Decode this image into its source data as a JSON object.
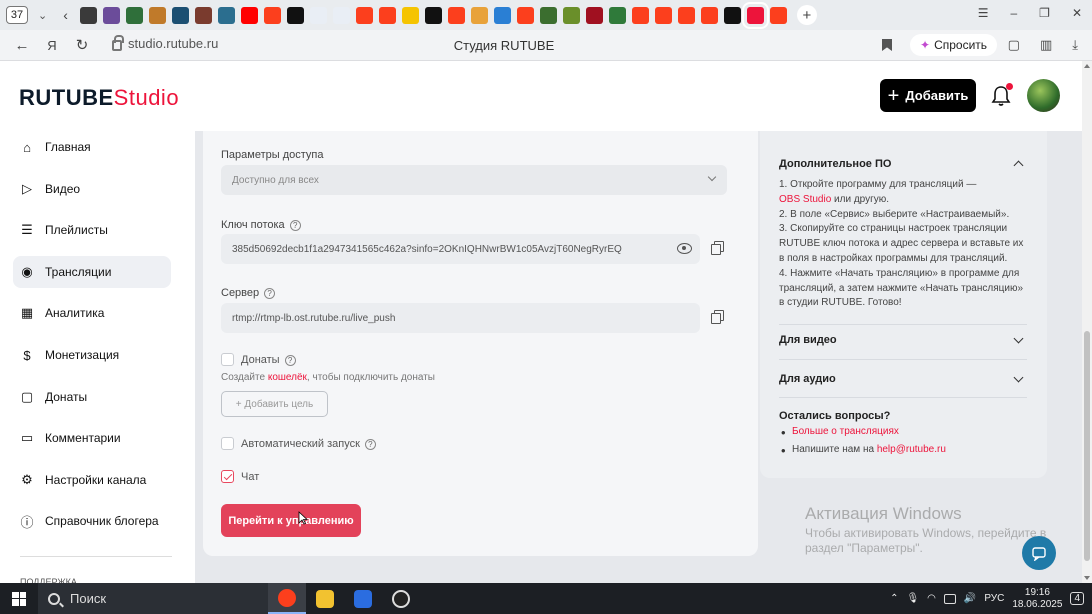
{
  "browser": {
    "tab_count": "37",
    "url": "studio.rutube.ru",
    "page_title": "Студия RUTUBE",
    "ask_label": "Спросить",
    "tab_icon_colors": [
      "#3a3a3a",
      "#6b4c9a",
      "#2f6f3a",
      "#c07a2a",
      "#1b4f72",
      "#7a3b2e",
      "#2b6e8f",
      "#ff0000",
      "#fc3f1d",
      "#111111",
      "#e9eef5",
      "#e9eef5",
      "#fc3f1d",
      "#fc3f1d",
      "#f5c400",
      "#111111",
      "#fc3f1d",
      "#e8a23a",
      "#2a7fd4",
      "#fc3f1d",
      "#3b6e2f",
      "#6a8f2a",
      "#a01020",
      "#2f7a3a",
      "#fc3f1d",
      "#fc3f1d",
      "#fc3f1d",
      "#fc3f1d",
      "#111111",
      "#ed143b",
      "#fc3f1d"
    ]
  },
  "header": {
    "logo_main": "RUTUBE",
    "logo_accent": "Studio",
    "add_button_label": "Добавить"
  },
  "sidebar": {
    "items": [
      {
        "label": "Главная",
        "icon": "home-icon"
      },
      {
        "label": "Видео",
        "icon": "video-icon"
      },
      {
        "label": "Плейлисты",
        "icon": "playlist-icon"
      },
      {
        "label": "Трансляции",
        "icon": "broadcast-icon"
      },
      {
        "label": "Аналитика",
        "icon": "analytics-icon"
      },
      {
        "label": "Монетизация",
        "icon": "monetization-icon"
      },
      {
        "label": "Донаты",
        "icon": "donate-icon"
      },
      {
        "label": "Комментарии",
        "icon": "comments-icon"
      },
      {
        "label": "Настройки канала",
        "icon": "settings-icon"
      },
      {
        "label": "Справочник блогера",
        "icon": "info-icon"
      }
    ],
    "active_item": "Трансляции",
    "footer_label": "ПОДДЕРЖКА"
  },
  "form": {
    "access_label": "Параметры доступа",
    "access_value": "Доступно для всех",
    "stream_key_label": "Ключ потока",
    "stream_key_value": "385d50692decb1f1a2947341565c462a?sinfo=2OKnIQHNwrBW1c05AvzjT60NegRyrEQ",
    "server_label": "Сервер",
    "server_value": "rtmp://rtmp-lb.ost.rutube.ru/live_push",
    "donations_label": "Донаты",
    "donations_hint_before": "Создайте",
    "donations_hint_link": "кошелёк",
    "donations_hint_after": ", чтобы подключить донаты",
    "add_goal_label": "+ Добавить цель",
    "autostart_label": "Автоматический запуск",
    "chat_label": "Чат",
    "go_to_control_label": "Перейти к управлению"
  },
  "info_panel": {
    "extra_software_title": "Дополнительное ПО",
    "step1_before": "1. Откройте программу для трансляций —",
    "step1_link": "OBS Studio",
    "step1_after": "или другую.",
    "step2": "2. В поле «Сервис» выберите «Настраиваемый».",
    "step3": "3. Скопируйте со страницы настроек трансляции RUTUBE ключ потока и адрес сервера и вставьте их в поля в настройках программы для трансляций.",
    "step4": "4. Нажмите «Начать трансляцию» в программе для трансляций, а затем нажмите «Начать трансляцию» в студии RUTUBE. Готово!",
    "for_video_title": "Для видео",
    "for_audio_title": "Для аудио",
    "questions_title": "Остались вопросы?",
    "more_link": "Больше о трансляциях",
    "write_before": "Напишите нам на",
    "write_email": "help@rutube.ru"
  },
  "watermark": {
    "title": "Активация Windows",
    "subtitle": "Чтобы активировать Windows, перейдите в раздел \"Параметры\"."
  },
  "taskbar": {
    "search_label": "Поиск",
    "language": "РУС",
    "time": "19:16",
    "date": "18.06.2025",
    "notifications": "4"
  }
}
